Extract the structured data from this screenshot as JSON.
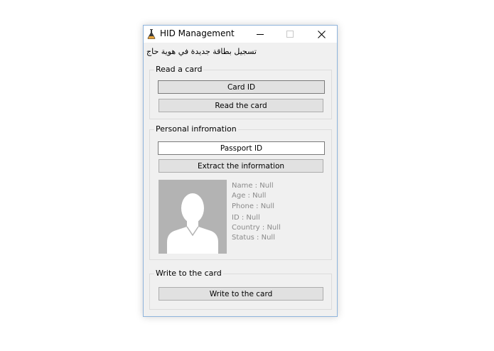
{
  "window": {
    "title": "HID Management",
    "subtitle": "تسجيل بطاقة جديدة في هوية حاج"
  },
  "read_card": {
    "legend": "Read a card",
    "card_id_label": "Card ID",
    "read_button_label": "Read the card"
  },
  "personal": {
    "legend": "Personal infromation",
    "passport_id_label": "Passport ID",
    "extract_button_label": "Extract the information",
    "fields": {
      "name": "Name : Null",
      "age": "Age : Null",
      "phone": "Phone : Null",
      "id": "ID : Null",
      "country": "Country : Null",
      "status": "Status : Null"
    }
  },
  "write_card": {
    "legend": "Write to the card",
    "write_button_label": "Write to the card"
  },
  "icons": {
    "app": "flask-icon",
    "minimize": "minimize-icon",
    "maximize": "maximize-icon",
    "close": "close-icon",
    "avatar": "user-placeholder-icon"
  },
  "colors": {
    "window_bg": "#f0f0f0",
    "border_accent": "#8fb4dc",
    "avatar_bg": "#b3b3b3",
    "info_text": "#8a8a8a"
  }
}
